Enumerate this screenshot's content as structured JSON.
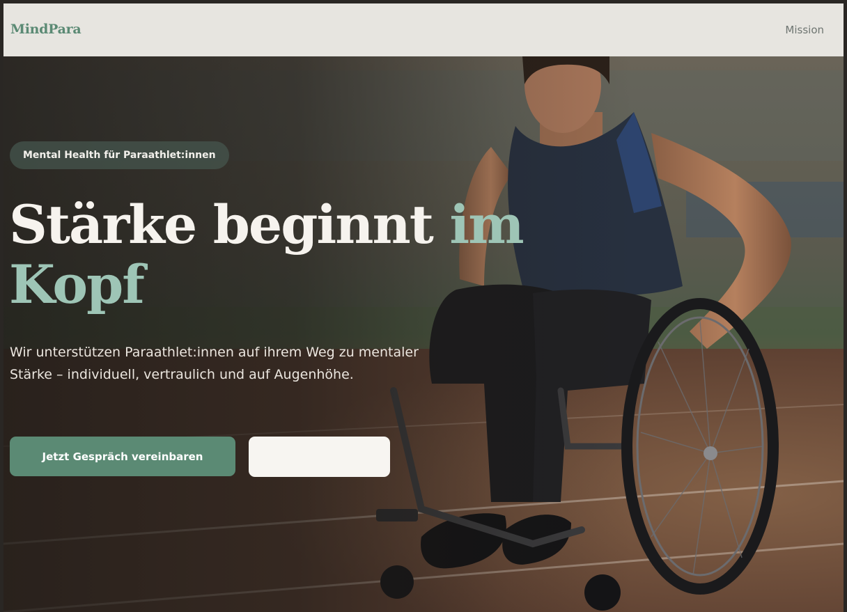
{
  "header": {
    "logo": "MindPara",
    "nav": [
      {
        "label": "Mission"
      }
    ]
  },
  "hero": {
    "badge": "Mental Health für Paraathlet:innen",
    "headline_main": "Stärke beginnt ",
    "headline_accent": "im Kopf",
    "subtitle": "Wir unterstützen Paraathlet:innen auf ihrem Weg zu mentaler Stärke – individuell, vertraulich und auf Augenhöhe.",
    "primary_button": "Jetzt Gespräch vereinbaren",
    "secondary_button": ""
  },
  "colors": {
    "brand": "#5b8a74",
    "accent": "#9ec5b6",
    "header_bg": "#e7e5e0",
    "nav_text": "#6e7571"
  }
}
